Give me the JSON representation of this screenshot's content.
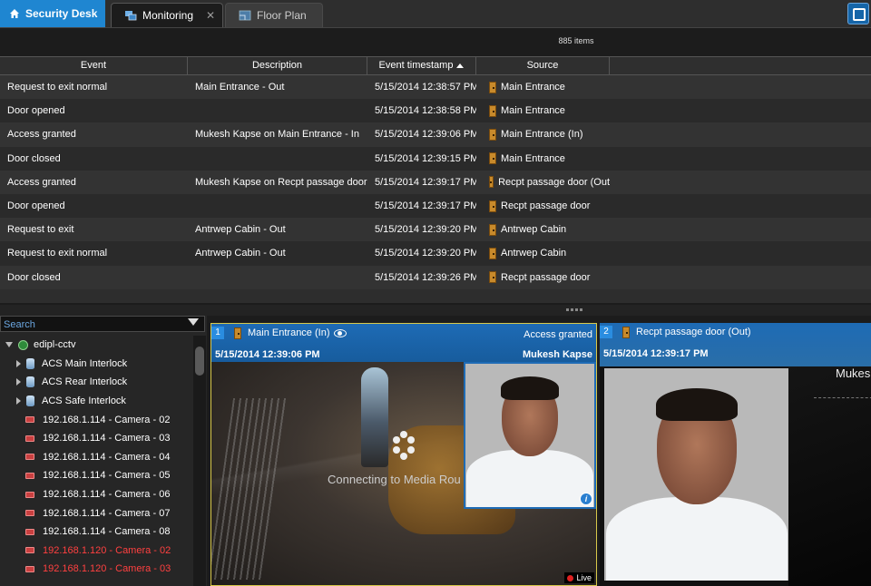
{
  "tabs": {
    "home": "Security Desk",
    "monitoring": "Monitoring",
    "floor_plan": "Floor Plan",
    "close": "✕"
  },
  "events": {
    "count": "885 items",
    "columns": [
      "Event",
      "Description",
      "Event timestamp",
      "Source"
    ],
    "rows": [
      {
        "event": "Request to exit normal",
        "description": "Main Entrance - Out",
        "timestamp": "5/15/2014 12:38:57 PM",
        "source": "Main Entrance"
      },
      {
        "event": "Door opened",
        "description": "",
        "timestamp": "5/15/2014 12:38:58 PM",
        "source": "Main Entrance"
      },
      {
        "event": "Access granted",
        "description": "Mukesh Kapse on Main Entrance - In",
        "timestamp": "5/15/2014 12:39:06 PM",
        "source": "Main Entrance (In)"
      },
      {
        "event": "Door closed",
        "description": "",
        "timestamp": "5/15/2014 12:39:15 PM",
        "source": "Main Entrance"
      },
      {
        "event": "Access granted",
        "description": "Mukesh Kapse on Recpt passage door - C",
        "timestamp": "5/15/2014 12:39:17 PM",
        "source": "Recpt passage door (Out"
      },
      {
        "event": "Door opened",
        "description": "",
        "timestamp": "5/15/2014 12:39:17 PM",
        "source": "Recpt passage door"
      },
      {
        "event": "Request to exit",
        "description": "Antrwep Cabin - Out",
        "timestamp": "5/15/2014 12:39:20 PM",
        "source": "Antrwep Cabin"
      },
      {
        "event": "Request to exit normal",
        "description": "Antrwep Cabin - Out",
        "timestamp": "5/15/2014 12:39:20 PM",
        "source": "Antrwep Cabin"
      },
      {
        "event": "Door closed",
        "description": "",
        "timestamp": "5/15/2014 12:39:26 PM",
        "source": "Recpt passage door"
      }
    ]
  },
  "tree": {
    "search_placeholder": "Search",
    "root": "edipl-cctv",
    "items": [
      {
        "label": "ACS Main Interlock",
        "type": "group"
      },
      {
        "label": "ACS Rear Interlock",
        "type": "group"
      },
      {
        "label": "ACS Safe Interlock",
        "type": "group"
      },
      {
        "label": "192.168.1.114 - Camera - 02",
        "type": "camera"
      },
      {
        "label": "192.168.1.114 - Camera - 03",
        "type": "camera"
      },
      {
        "label": "192.168.1.114 - Camera - 04",
        "type": "camera"
      },
      {
        "label": "192.168.1.114 - Camera - 05",
        "type": "camera"
      },
      {
        "label": "192.168.1.114 - Camera - 06",
        "type": "camera"
      },
      {
        "label": "192.168.1.114 - Camera - 07",
        "type": "camera"
      },
      {
        "label": "192.168.1.114 - Camera - 08",
        "type": "camera"
      },
      {
        "label": "192.168.1.120 - Camera - 02",
        "type": "camera-offline"
      },
      {
        "label": "192.168.1.120 - Camera - 03",
        "type": "camera-offline"
      }
    ]
  },
  "tile1": {
    "number": "1",
    "title": "Main Entrance (In)",
    "event": "Access granted",
    "time": "5/15/2014 12:39:06 PM",
    "user": "Mukesh Kapse",
    "status": "Connecting to Media Rou",
    "live": "Live",
    "info": "i"
  },
  "tile2": {
    "number": "2",
    "title": "Recpt passage door (Out)",
    "time": "5/15/2014 12:39:17 PM",
    "user": "Mukes"
  },
  "colors": {
    "accent": "#1f86d1",
    "tile_header": "#1e6bb5",
    "selected_border": "#d8c84a",
    "offline": "#ff4040",
    "door": "#c88a2b"
  },
  "icons": {
    "home": "home-icon",
    "monitoring": "monitoring-icon",
    "floor_plan": "floor-plan-icon",
    "door": "door-icon",
    "camera": "camera-icon",
    "filter": "filter-icon",
    "eye": "eye-icon",
    "info": "info-icon"
  }
}
